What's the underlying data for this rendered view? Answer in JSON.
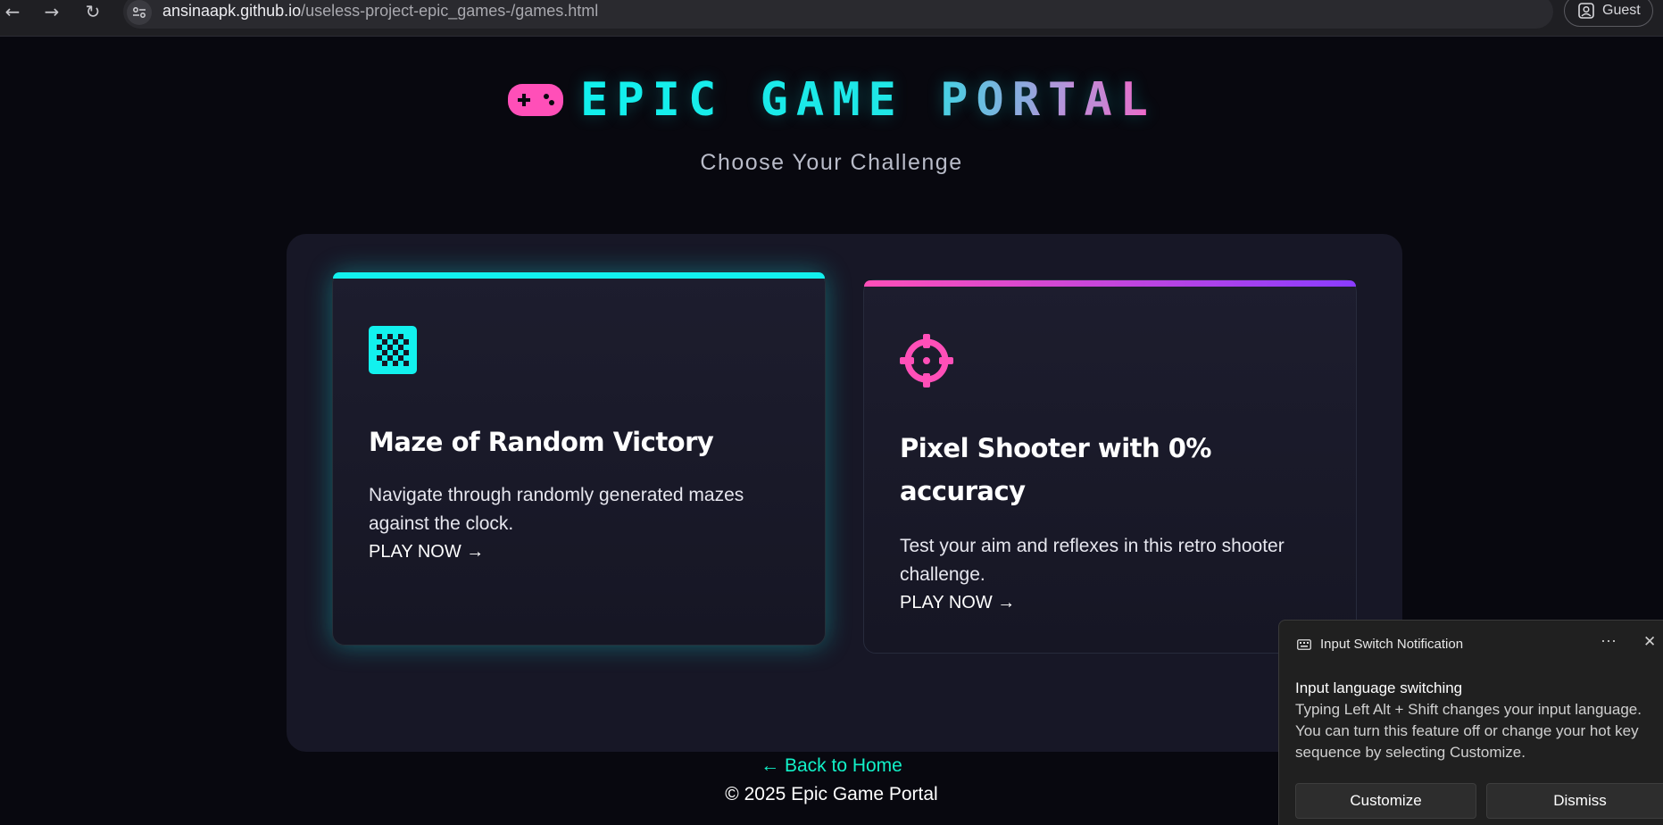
{
  "browser": {
    "url_host": "ansinaapk.github.io",
    "url_path": "/useless-project-epic_games-/games.html",
    "profile_label": "Guest"
  },
  "header": {
    "title": "EPIC GAME PORTAL",
    "subtitle": "Choose Your Challenge"
  },
  "games": [
    {
      "title": "Maze of Random Victory",
      "description": "Navigate through randomly generated mazes against the clock.",
      "link": "PLAY NOW →",
      "icon": "checkerboard-icon",
      "accent": "#12f1ee"
    },
    {
      "title": "Pixel Shooter with 0% accuracy",
      "description": "Test your aim and reflexes in this retro shooter challenge.",
      "link": "PLAY NOW →",
      "icon": "crosshair-icon",
      "accent": "#ff4fb8"
    }
  ],
  "footer": {
    "back_link": "← Back to Home",
    "copyright": "© 2025 Epic Game Portal"
  },
  "notification": {
    "app": "Input Switch Notification",
    "title": "Input language switching",
    "body": "Typing Left Alt + Shift changes your input language. You can turn this feature off or change your hot key sequence by selecting Customize.",
    "customize_label": "Customize",
    "dismiss_label": "Dismiss"
  },
  "colors": {
    "background": "#08080f",
    "panel": "#171726",
    "cyan": "#12f1ee",
    "pink": "#ff4fb8",
    "purple": "#8a3cff"
  }
}
